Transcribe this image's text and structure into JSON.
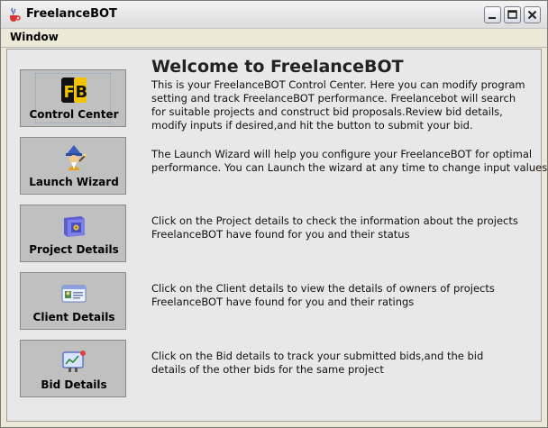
{
  "window": {
    "title": "FreelanceBOT"
  },
  "menu": {
    "items": [
      "Window"
    ]
  },
  "main": {
    "heading": "Welcome to FreelanceBOT",
    "intro_lines": [
      "This is your FreelanceBOT Control Center. Here you can modify program",
      "setting and track FreelanceBOT performance. Freelancebot will search",
      "for suitable projects and construct bid proposals.Review bid details,",
      "modify inputs if desired,and hit the button to submit your bid."
    ]
  },
  "nav": [
    {
      "label": "Control Center",
      "icon": "fb-logo-icon",
      "desc_lines": []
    },
    {
      "label": "Launch Wizard",
      "icon": "wizard-icon",
      "desc_lines": [
        "The Launch  Wizard will help you configure your FreelanceBOT for optimal",
        "performance. You can Launch the wizard at any time to change input values"
      ]
    },
    {
      "label": "Project Details",
      "icon": "safe-icon",
      "desc_lines": [
        "Click on the Project details to check the information about the projects",
        "FreelanceBOT  have found for you and their status"
      ]
    },
    {
      "label": "Client Details",
      "icon": "id-card-icon",
      "desc_lines": [
        "Click on the Client details to view the details of owners of projects",
        "FreelanceBOT  have found for you and their ratings"
      ]
    },
    {
      "label": "Bid  Details",
      "icon": "bid-board-icon",
      "desc_lines": [
        "Click on the Bid details to track your submitted bids,and the bid",
        "details of the other bids for the same project"
      ]
    }
  ],
  "colors": {
    "button_bg": "#c0c0c0",
    "logo_yellow": "#f2c300",
    "accent_blue": "#3a5fbf"
  }
}
